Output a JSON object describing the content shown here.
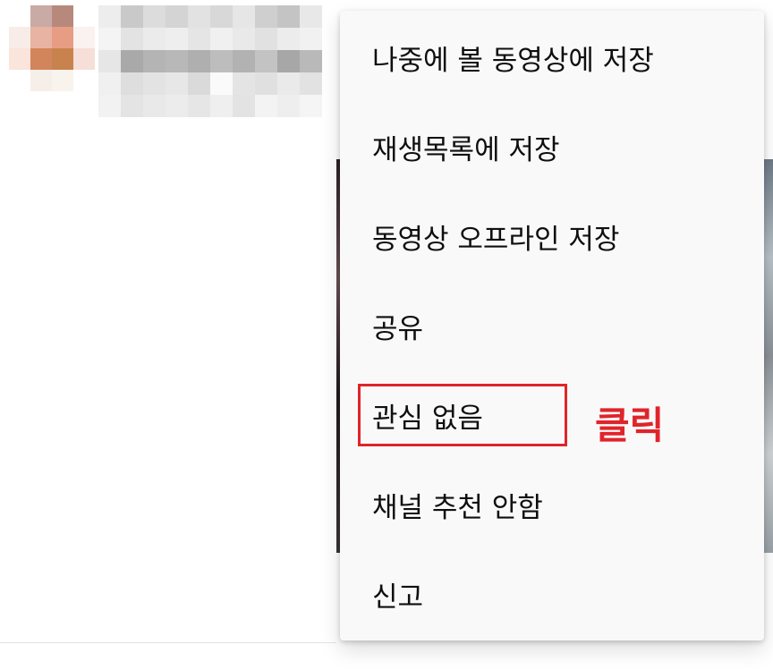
{
  "menu": {
    "items": [
      {
        "label": "나중에 볼 동영상에 저장"
      },
      {
        "label": "재생목록에 저장"
      },
      {
        "label": "동영상 오프라인 저장"
      },
      {
        "label": "공유"
      },
      {
        "label": "관심 없음"
      },
      {
        "label": "채널 추천 안함"
      },
      {
        "label": "신고"
      }
    ]
  },
  "annotation": {
    "label": "클릭",
    "highlighted_item": "관심 없음",
    "color": "#e0242a"
  },
  "colors": {
    "menu_background": "#f9f9f9",
    "menu_text": "#0f0f0f"
  }
}
